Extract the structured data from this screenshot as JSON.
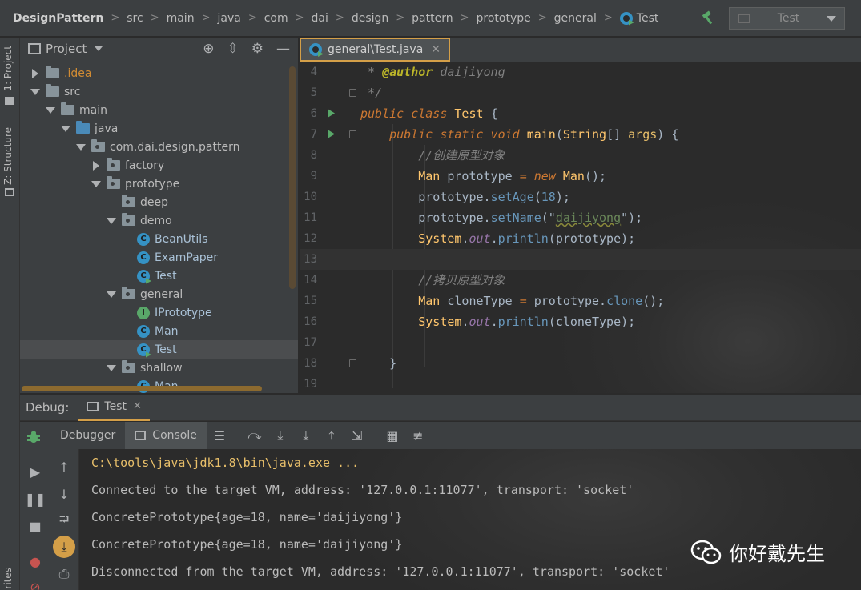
{
  "breadcrumbs": [
    "DesignPattern",
    "src",
    "main",
    "java",
    "com",
    "dai",
    "design",
    "pattern",
    "prototype",
    "general",
    "Test"
  ],
  "run_config": {
    "label": "Test"
  },
  "left_stripe": {
    "project_tab": "1: Project",
    "structure_tab": "Z: Structure",
    "favorites_tab": "rites"
  },
  "project_panel": {
    "title": "Project",
    "tree": [
      {
        "label": ".idea",
        "depth": 0,
        "arrow": "right",
        "icon": "folder",
        "style": "excluded"
      },
      {
        "label": "src",
        "depth": 0,
        "arrow": "down",
        "icon": "folder"
      },
      {
        "label": "main",
        "depth": 1,
        "arrow": "down",
        "icon": "folder"
      },
      {
        "label": "java",
        "depth": 2,
        "arrow": "down",
        "icon": "src-folder"
      },
      {
        "label": "com.dai.design.pattern",
        "depth": 3,
        "arrow": "down",
        "icon": "package"
      },
      {
        "label": "factory",
        "depth": 4,
        "arrow": "right",
        "icon": "package"
      },
      {
        "label": "prototype",
        "depth": 4,
        "arrow": "down",
        "icon": "package"
      },
      {
        "label": "deep",
        "depth": 5,
        "arrow": "none",
        "icon": "package"
      },
      {
        "label": "demo",
        "depth": 5,
        "arrow": "down",
        "icon": "package"
      },
      {
        "label": "BeanUtils",
        "depth": 6,
        "arrow": "none",
        "icon": "class",
        "style": "javafile"
      },
      {
        "label": "ExamPaper",
        "depth": 6,
        "arrow": "none",
        "icon": "class",
        "style": "javafile"
      },
      {
        "label": "Test",
        "depth": 6,
        "arrow": "none",
        "icon": "class-run",
        "style": "javafile"
      },
      {
        "label": "general",
        "depth": 5,
        "arrow": "down",
        "icon": "package"
      },
      {
        "label": "IPrototype",
        "depth": 6,
        "arrow": "none",
        "icon": "interface",
        "style": "iface"
      },
      {
        "label": "Man",
        "depth": 6,
        "arrow": "none",
        "icon": "class",
        "style": "javafile"
      },
      {
        "label": "Test",
        "depth": 6,
        "arrow": "none",
        "icon": "class-run",
        "style": "javafile",
        "selected": true
      },
      {
        "label": "shallow",
        "depth": 5,
        "arrow": "down",
        "icon": "package"
      },
      {
        "label": "Man",
        "depth": 6,
        "arrow": "none",
        "icon": "class",
        "style": "javafile"
      }
    ]
  },
  "editor": {
    "tab_label": "general\\Test.java",
    "lines": [
      {
        "n": "4",
        "tokens": [
          [
            "cm",
            " * "
          ],
          [
            "ann",
            "@author"
          ],
          [
            "cm",
            " daijiyong"
          ]
        ]
      },
      {
        "n": "5",
        "tokens": [
          [
            "cm",
            " */"
          ]
        ]
      },
      {
        "n": "6",
        "run": true,
        "tokens": [
          [
            "k",
            "public class "
          ],
          [
            "clsname",
            "Test"
          ],
          [
            "id",
            " {"
          ]
        ]
      },
      {
        "n": "7",
        "run": true,
        "tokens": [
          [
            "id",
            "    "
          ],
          [
            "k",
            "public static void "
          ],
          [
            "fn",
            "main"
          ],
          [
            "id",
            "("
          ],
          [
            "ctype",
            "String"
          ],
          [
            "id",
            "[] "
          ],
          [
            "tyn",
            "args"
          ],
          [
            "id",
            ") {"
          ]
        ]
      },
      {
        "n": "8",
        "tokens": [
          [
            "id",
            "        "
          ],
          [
            "cm",
            "//创建原型对象"
          ]
        ]
      },
      {
        "n": "9",
        "tokens": [
          [
            "id",
            "        "
          ],
          [
            "ctype",
            "Man"
          ],
          [
            "id",
            " prototype "
          ],
          [
            "ty",
            "="
          ],
          [
            "id",
            " "
          ],
          [
            "k",
            "new "
          ],
          [
            "ctype",
            "Man"
          ],
          [
            "id",
            "();"
          ]
        ]
      },
      {
        "n": "10",
        "tokens": [
          [
            "id",
            "        prototype."
          ],
          [
            "m",
            "setAge"
          ],
          [
            "id",
            "("
          ],
          [
            "m",
            "18"
          ],
          [
            "id",
            ");"
          ]
        ]
      },
      {
        "n": "11",
        "tokens": [
          [
            "id",
            "        prototype."
          ],
          [
            "m",
            "setName"
          ],
          [
            "id",
            "(\""
          ],
          [
            "st-typo",
            "daijiyong"
          ],
          [
            "id",
            "\");"
          ]
        ]
      },
      {
        "n": "12",
        "tokens": [
          [
            "id",
            "        "
          ],
          [
            "ctype",
            "System"
          ],
          [
            "id",
            "."
          ],
          [
            "fld",
            "out"
          ],
          [
            "id",
            "."
          ],
          [
            "m",
            "println"
          ],
          [
            "id",
            "(prototype);"
          ]
        ]
      },
      {
        "n": "13",
        "current": true,
        "tokens": []
      },
      {
        "n": "14",
        "tokens": [
          [
            "id",
            "        "
          ],
          [
            "cm",
            "//拷贝原型对象"
          ]
        ]
      },
      {
        "n": "15",
        "tokens": [
          [
            "id",
            "        "
          ],
          [
            "ctype",
            "Man"
          ],
          [
            "id",
            " cloneType "
          ],
          [
            "ty",
            "="
          ],
          [
            "id",
            " prototype."
          ],
          [
            "m",
            "clone"
          ],
          [
            "id",
            "();"
          ]
        ]
      },
      {
        "n": "16",
        "tokens": [
          [
            "id",
            "        "
          ],
          [
            "ctype",
            "System"
          ],
          [
            "id",
            "."
          ],
          [
            "fld",
            "out"
          ],
          [
            "id",
            "."
          ],
          [
            "m",
            "println"
          ],
          [
            "id",
            "(cloneType);"
          ]
        ]
      },
      {
        "n": "17",
        "tokens": []
      },
      {
        "n": "18",
        "tokens": [
          [
            "id",
            "    }"
          ]
        ]
      },
      {
        "n": "19",
        "tokens": []
      }
    ]
  },
  "debug": {
    "title": "Debug:",
    "session_tab": "Test",
    "subtabs": {
      "debugger": "Debugger",
      "console": "Console"
    }
  },
  "console": {
    "lines": [
      "C:\\tools\\java\\jdk1.8\\bin\\java.exe ...",
      "Connected to the target VM, address: '127.0.0.1:11077', transport: 'socket'",
      "ConcretePrototype{age=18, name='daijiyong'}",
      "ConcretePrototype{age=18, name='daijiyong'}",
      "Disconnected from the target VM, address: '127.0.0.1:11077', transport: 'socket'"
    ],
    "first_line_color": "#e8bf6a"
  },
  "watermark": {
    "text": "你好戴先生"
  }
}
